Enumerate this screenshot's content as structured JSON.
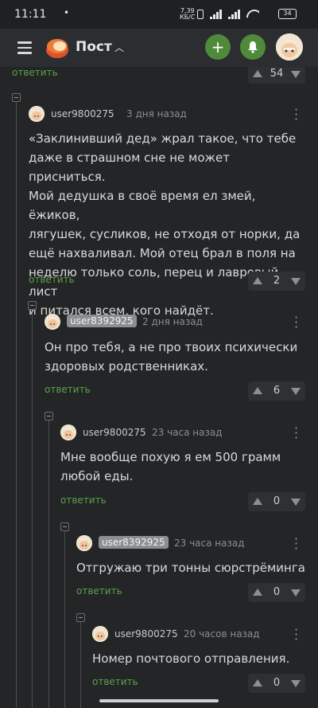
{
  "status": {
    "time": "11:11",
    "speed_value": "7,39",
    "speed_unit": "КБ/С",
    "battery": "34"
  },
  "header": {
    "title": "Пост",
    "chevron": "^",
    "add_icon": "plus-icon",
    "bell_icon": "bell-icon"
  },
  "top_partial": {
    "reply": "ответить",
    "rating": "54"
  },
  "comments": [
    {
      "user": "user9800275",
      "time": "3 дня назад",
      "text_lines": [
        "«Заклинивший дед» жрал такое, что тебе",
        "даже в страшном сне не может присниться.",
        "Мой дедушка в своё время ел змей, ёжиков,",
        "лягушек, сусликов, не отходя от норки, да",
        "ещё нахваливал. Мой отец брал в поля на",
        "неделю только соль, перец и лавровый лист",
        "и питался всем, кого найдёт."
      ],
      "reply": "ответить",
      "rating": "2"
    },
    {
      "user": "user8392925",
      "time": "2 дня назад",
      "text_lines": [
        "Он про тебя, а не про твоих психически",
        "здоровых родственниках."
      ],
      "reply": "ответить",
      "rating": "6"
    },
    {
      "user": "user9800275",
      "time": "23 часа назад",
      "text_lines": [
        "Мне вообще похую я ем 500 грамм",
        "любой еды."
      ],
      "reply": "ответить",
      "rating": "0"
    },
    {
      "user": "user8392925",
      "time": "23 часа назад",
      "text_lines": [
        "Отгружаю три тонны сюрстрёминга"
      ],
      "reply": "ответить",
      "rating": "0"
    },
    {
      "user": "user9800275",
      "time": "20 часов назад",
      "text_lines": [
        "Номер почтового отправления."
      ],
      "reply": "ответить",
      "rating": "0"
    }
  ]
}
